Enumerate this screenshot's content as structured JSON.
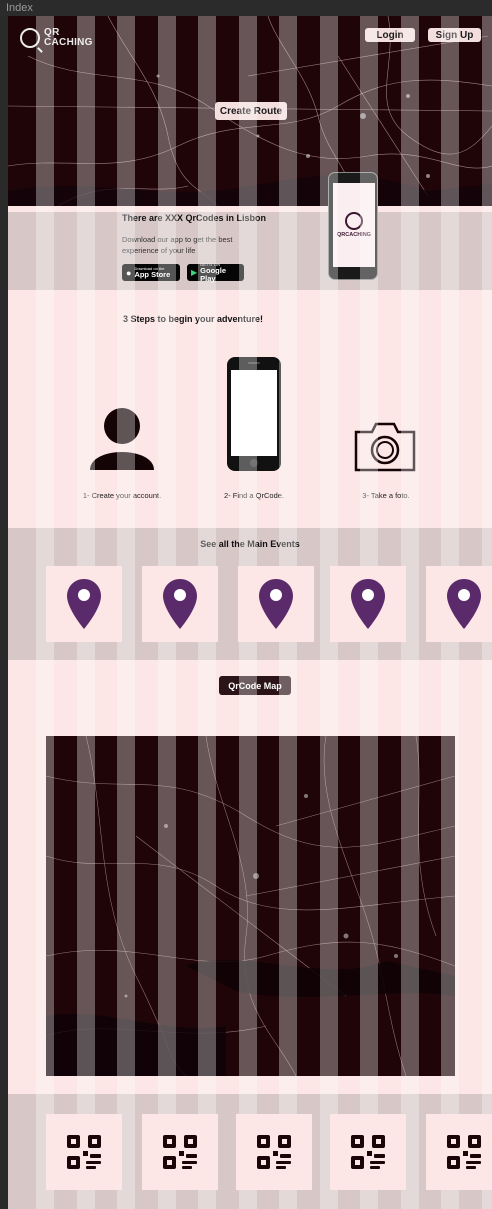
{
  "window": {
    "tab_title": "Index"
  },
  "header": {
    "logo_text_top": "QR",
    "logo_text_bottom": "CACHING",
    "login_label": "Login",
    "signup_label": "Sign Up",
    "create_route_label": "Create Route"
  },
  "promo": {
    "title": "There are XXX QrCodes in Lisbon",
    "subtitle": "Download our app to get the best experience of your life",
    "app_store_small": "Download on the",
    "app_store_big": "App Store",
    "google_play_small": "GET IT ON",
    "google_play_big": "Google Play",
    "phone_brand": "QRCACHING"
  },
  "steps": {
    "title": "3 Steps to begin your adventure!",
    "items": [
      {
        "label": "1- Create your account.",
        "icon": "user-icon"
      },
      {
        "label": "2- Find a QrCode.",
        "icon": "phone-icon"
      },
      {
        "label": "3- Take a foto.",
        "icon": "camera-icon"
      }
    ]
  },
  "events": {
    "title": "See all the Main Events",
    "pin_color": "#5b2a6b",
    "cards": [
      "location-pin-icon",
      "location-pin-icon",
      "location-pin-icon",
      "location-pin-icon",
      "location-pin-icon"
    ]
  },
  "map_section": {
    "button_label": "QrCode Map"
  },
  "qr_section": {
    "cards": [
      "qr-code-icon",
      "qr-code-icon",
      "qr-code-icon",
      "qr-code-icon",
      "qr-code-icon"
    ]
  },
  "colors": {
    "page_bg": "#fde6e6",
    "band_bg": "#d7c7c7",
    "map_bg": "#1f0508",
    "accent_dark": "#2b1418"
  }
}
